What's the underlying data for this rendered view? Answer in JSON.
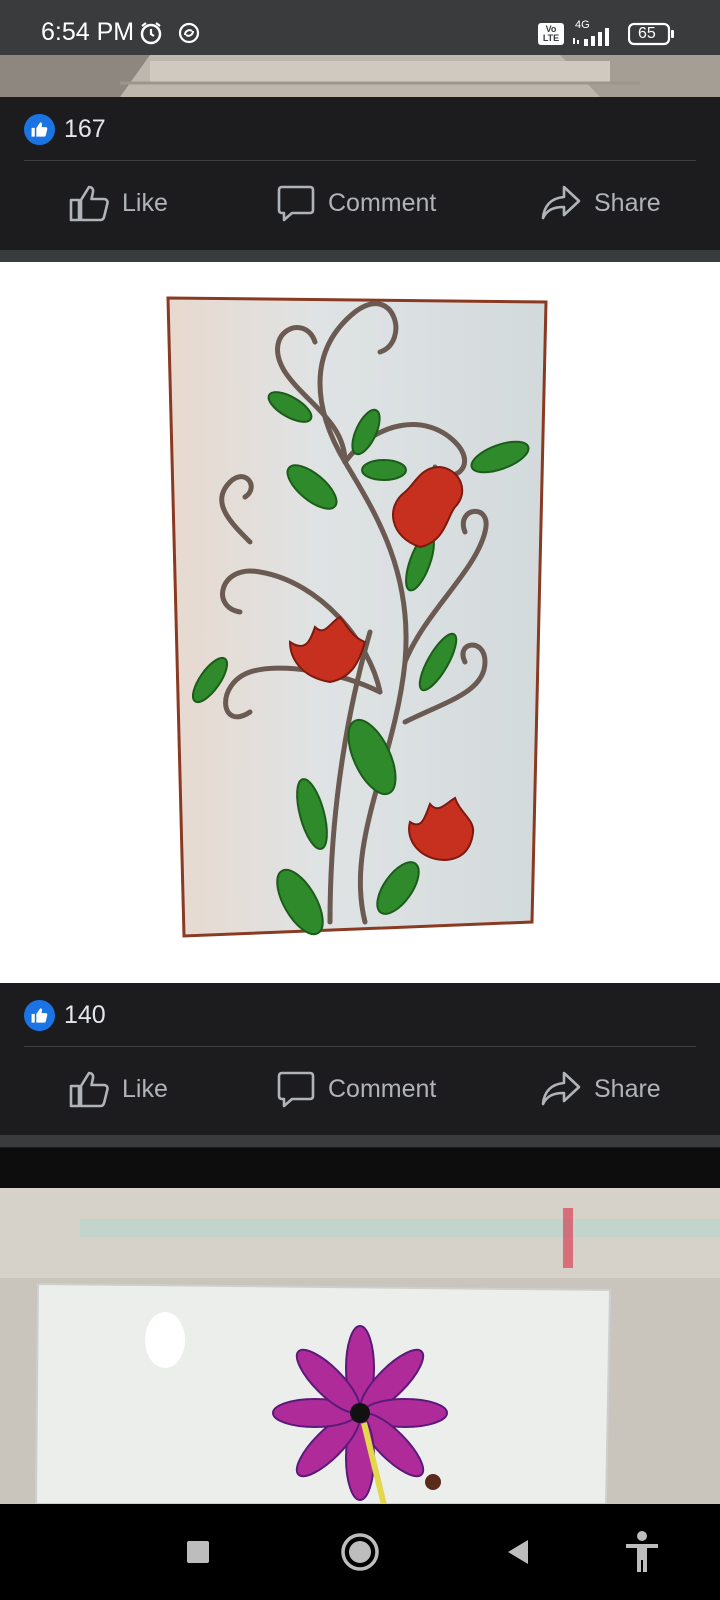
{
  "status_bar": {
    "time": "6:54 PM",
    "icons": [
      "alarm-icon",
      "sync-icon",
      "volte-icon",
      "signal-4g-icon",
      "battery-icon"
    ],
    "network_label": "4G",
    "volte_label": "Vo LTE",
    "battery_level": "65"
  },
  "posts": [
    {
      "reaction_count": "167",
      "actions": {
        "like": "Like",
        "comment": "Comment",
        "share": "Share"
      }
    },
    {
      "reaction_count": "140",
      "actions": {
        "like": "Like",
        "comment": "Comment",
        "share": "Share"
      }
    }
  ],
  "nav_bar": {
    "icons": [
      "recents-square-icon",
      "home-circle-icon",
      "back-triangle-icon",
      "accessibility-icon"
    ]
  },
  "colors": {
    "background": "#1c1c1e",
    "separator": "#3a3b3c",
    "like_blue": "#1b74e4",
    "action_text": "#b0b3b8"
  }
}
